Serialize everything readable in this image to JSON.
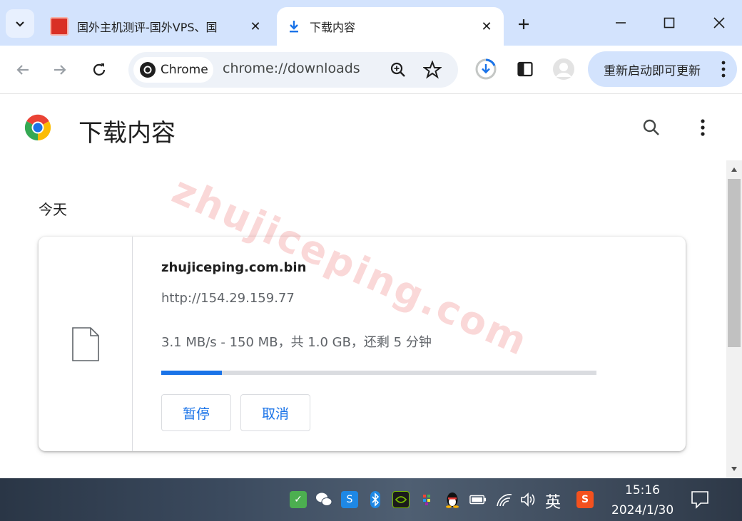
{
  "tabs": {
    "inactive": {
      "title": "国外主机测评-国外VPS、国"
    },
    "active": {
      "title": "下载内容"
    }
  },
  "toolbar": {
    "chip_label": "Chrome",
    "url": "chrome://downloads",
    "relaunch_label": "重新启动即可更新"
  },
  "page": {
    "title": "下载内容",
    "date_group": "今天",
    "watermark": "zhujiceping.com"
  },
  "download": {
    "file_name": "zhujiceping.com.bin",
    "source_url": "http://154.29.159.77",
    "status": "3.1 MB/s - 150 MB，共 1.0 GB，还剩 5 分钟",
    "progress": 0.14,
    "pause_label": "暂停",
    "cancel_label": "取消"
  },
  "taskbar": {
    "ime": "英",
    "time": "15:16",
    "date": "2024/1/30"
  },
  "colors": {
    "tabstrip": "#d3e3fd",
    "accent": "#1a73e8",
    "progress_track": "#dadce0"
  }
}
